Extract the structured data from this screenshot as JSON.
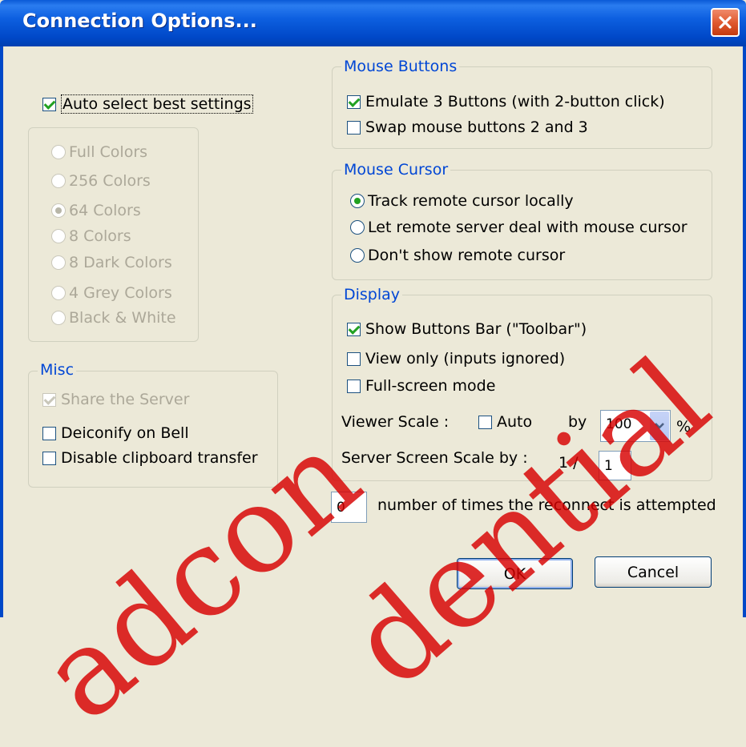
{
  "window": {
    "title": "Connection Options..."
  },
  "auto_select": {
    "label": "Auto select best settings",
    "checked": true
  },
  "colors": {
    "options": [
      {
        "label": "Full Colors",
        "selected": false
      },
      {
        "label": "256 Colors",
        "selected": false
      },
      {
        "label": "64 Colors",
        "selected": true
      },
      {
        "label": "8 Colors",
        "selected": false
      },
      {
        "label": "8 Dark Colors",
        "selected": false
      },
      {
        "label": "4 Grey Colors",
        "selected": false
      },
      {
        "label": "Black & White",
        "selected": false
      }
    ]
  },
  "misc": {
    "legend": "Misc",
    "share_server": {
      "label": "Share the Server",
      "checked": true
    },
    "deiconify": {
      "label": "Deiconify on Bell",
      "checked": false
    },
    "disable_clipboard": {
      "label": "Disable clipboard transfer",
      "checked": false
    }
  },
  "mouse_buttons": {
    "legend": "Mouse Buttons",
    "emulate3": {
      "label": "Emulate 3 Buttons (with 2-button click)",
      "checked": true
    },
    "swap": {
      "label": "Swap mouse buttons 2 and 3",
      "checked": false
    }
  },
  "mouse_cursor": {
    "legend": "Mouse Cursor",
    "options": [
      {
        "label": "Track remote cursor locally",
        "selected": true
      },
      {
        "label": "Let remote server deal with mouse cursor",
        "selected": false
      },
      {
        "label": "Don't show remote cursor",
        "selected": false
      }
    ]
  },
  "display": {
    "legend": "Display",
    "toolbar": {
      "label": "Show Buttons Bar (\"Toolbar\")",
      "checked": true
    },
    "view_only": {
      "label": "View only (inputs ignored)",
      "checked": false
    },
    "fullscreen": {
      "label": "Full-screen mode",
      "checked": false
    },
    "viewer_scale_label": "Viewer Scale :",
    "auto_label": "Auto",
    "auto_checked": false,
    "by_label": "by",
    "scale_value": "100",
    "percent_label": "%",
    "server_scale_label": "Server Screen Scale by :",
    "server_scale_prefix": "1  /",
    "server_scale_value": "1"
  },
  "reconnect": {
    "value": "0",
    "label": "number of times the reconnect is attempted"
  },
  "buttons": {
    "ok": "OK",
    "cancel": "Cancel"
  },
  "colors_palette": {
    "accent": "#0046d5",
    "titlebar": "#0048c8",
    "background": "#ece9d8",
    "check": "#21a121",
    "watermark": "#d70000"
  }
}
